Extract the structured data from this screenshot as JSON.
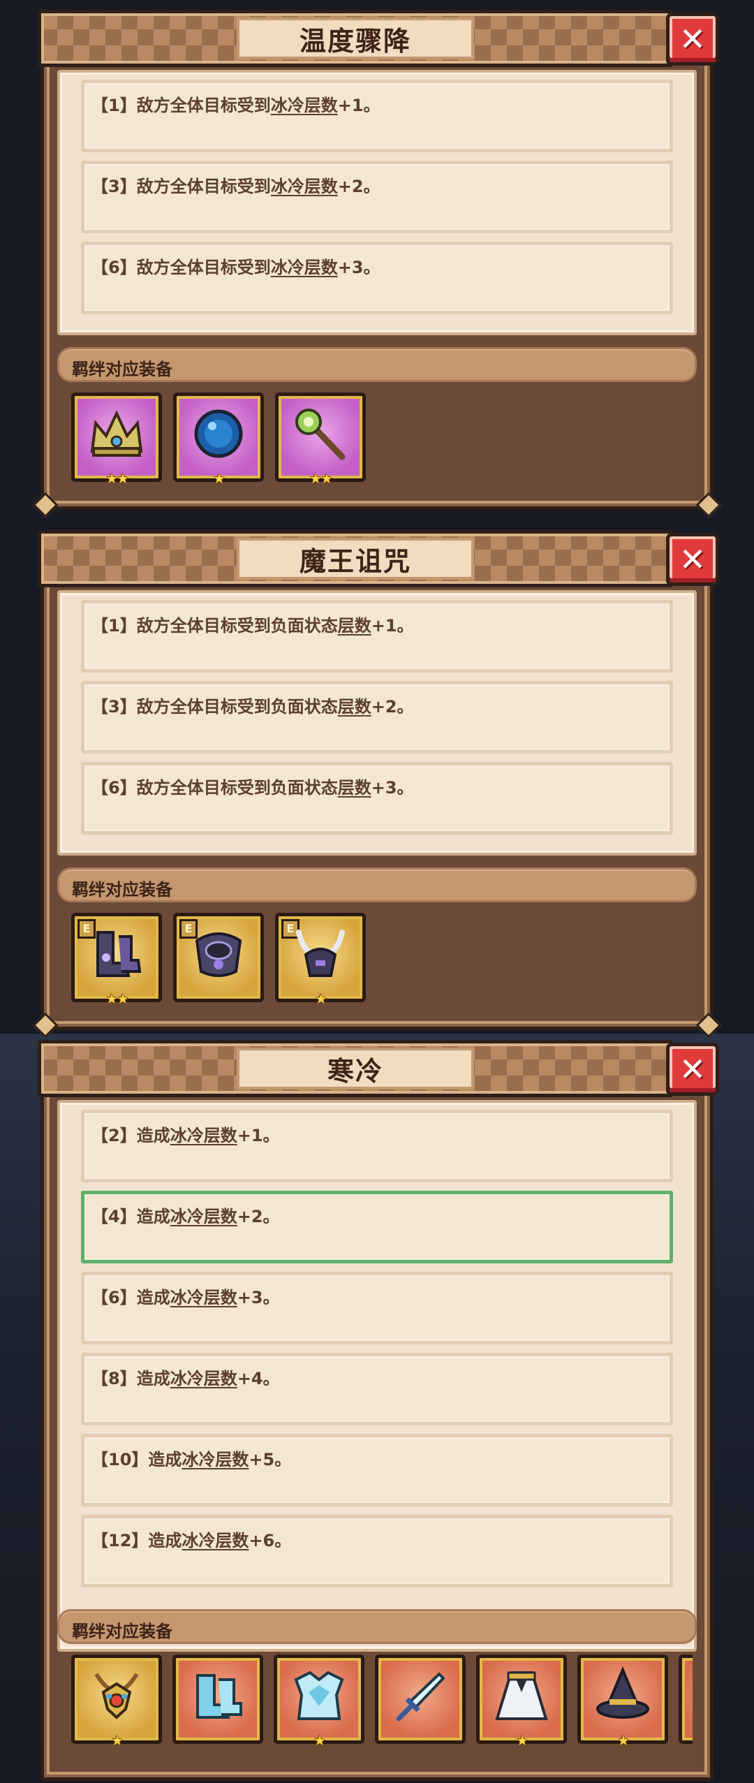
{
  "panels": [
    {
      "title": "温度骤降",
      "close_icon": "✕",
      "entries": [
        {
          "prefix": "【1】敌方全体目标受到",
          "keyword": "冰冷层数",
          "suffix": "+1。"
        },
        {
          "prefix": "【3】敌方全体目标受到",
          "keyword": "冰冷层数",
          "suffix": "+2。"
        },
        {
          "prefix": "【6】敌方全体目标受到",
          "keyword": "冰冷层数",
          "suffix": "+3。"
        }
      ],
      "equip_label": "羁绊对应装备",
      "equipment": [
        {
          "icon": "crown-icon",
          "bg": "purple",
          "stars": "★★"
        },
        {
          "icon": "orb-icon",
          "bg": "purple",
          "stars": "★"
        },
        {
          "icon": "scepter-icon",
          "bg": "purple",
          "stars": "★★"
        }
      ]
    },
    {
      "title": "魔王诅咒",
      "close_icon": "✕",
      "entries": [
        {
          "prefix": "【1】敌方全体目标受到负面状态",
          "keyword": "层数",
          "suffix": "+1。"
        },
        {
          "prefix": "【3】敌方全体目标受到负面状态",
          "keyword": "层数",
          "suffix": "+2。"
        },
        {
          "prefix": "【6】敌方全体目标受到负面状态",
          "keyword": "层数",
          "suffix": "+3。"
        }
      ],
      "equip_label": "羁绊对应装备",
      "equipment": [
        {
          "icon": "boots-icon",
          "bg": "gold",
          "stars": "★★",
          "elite": "E"
        },
        {
          "icon": "armor-icon",
          "bg": "gold",
          "stars": "",
          "elite": "E"
        },
        {
          "icon": "helmet-icon",
          "bg": "gold",
          "stars": "★",
          "elite": "E"
        }
      ]
    },
    {
      "title": "寒冷",
      "close_icon": "✕",
      "entries": [
        {
          "prefix": "【2】造成",
          "keyword": "冰冷层数",
          "suffix": "+1。"
        },
        {
          "prefix": "【4】造成",
          "keyword": "冰冷层数",
          "suffix": "+2。",
          "active": true
        },
        {
          "prefix": "【6】造成",
          "keyword": "冰冷层数",
          "suffix": "+3。"
        },
        {
          "prefix": "【8】造成",
          "keyword": "冰冷层数",
          "suffix": "+4。"
        },
        {
          "prefix": "【10】造成",
          "keyword": "冰冷层数",
          "suffix": "+5。"
        },
        {
          "prefix": "【12】造成",
          "keyword": "冰冷层数",
          "suffix": "+6。"
        }
      ],
      "equip_label": "羁绊对应装备",
      "equipment": [
        {
          "icon": "amulet-icon",
          "bg": "gold",
          "stars": "★"
        },
        {
          "icon": "ice-boots-icon",
          "bg": "orange",
          "stars": ""
        },
        {
          "icon": "ice-armor-icon",
          "bg": "orange",
          "stars": "★"
        },
        {
          "icon": "ice-sword-icon",
          "bg": "orange",
          "stars": ""
        },
        {
          "icon": "cloak-icon",
          "bg": "orange",
          "stars": "★"
        },
        {
          "icon": "wizard-hat-icon",
          "bg": "orange",
          "stars": "★"
        }
      ]
    }
  ]
}
